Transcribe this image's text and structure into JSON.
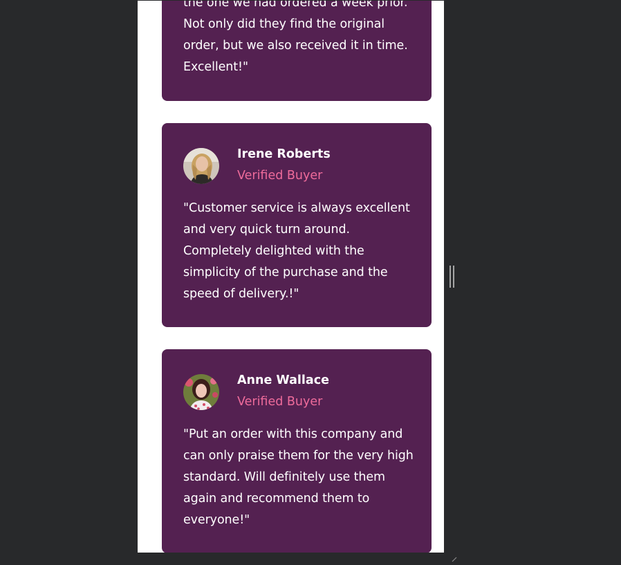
{
  "testimonials": [
    {
      "quote": "the one we had ordered a week prior. Not only did they find the original order, but we also received it in time. Excellent!\""
    },
    {
      "name": "Irene Roberts",
      "badge": "Verified Buyer",
      "quote": "\"Customer service is always excellent and very quick turn around. Completely delighted with the simplicity of the purchase and the speed of delivery.!\""
    },
    {
      "name": "Anne Wallace",
      "badge": "Verified Buyer",
      "quote": "\"Put an order with this company and can only praise them for the very high standard. Will definitely use them again and recommend them to everyone!\""
    }
  ],
  "colors": {
    "card_background": "#542151",
    "verified_accent": "#ee6b9b",
    "page_background": "#28292b"
  },
  "icons": {
    "resize_handle": "vertical-resize-handle-icon"
  }
}
